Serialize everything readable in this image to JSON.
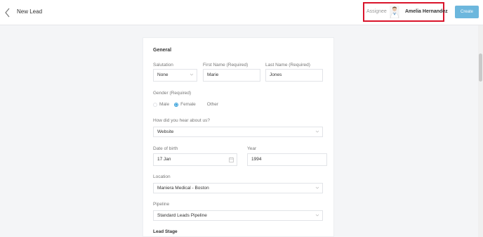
{
  "header": {
    "title": "New Lead",
    "assignee_label": "Assignee",
    "assignee_name": "Amelia Hernandez",
    "create_label": "Create"
  },
  "form": {
    "section_title": "General",
    "salutation": {
      "label": "Salutation",
      "value": "None"
    },
    "first_name": {
      "label": "First Name (Required)",
      "value": "Marie"
    },
    "last_name": {
      "label": "Last Name (Required)",
      "value": "Jones"
    },
    "gender": {
      "label": "Gender (Required)",
      "options": [
        "Male",
        "Female",
        "Other"
      ],
      "selected": "Female"
    },
    "source": {
      "label": "How did you hear about us?",
      "value": "Website"
    },
    "dob": {
      "label": "Date of birth",
      "value": "17 Jan"
    },
    "year": {
      "label": "Year",
      "value": "1994"
    },
    "location": {
      "label": "Location",
      "value": "Maniera Medical - Boston"
    },
    "pipeline": {
      "label": "Pipeline",
      "value": "Standard Leads Pipeline"
    },
    "lead_stage": {
      "label": "Lead Stage"
    }
  },
  "icons": {
    "back": "chevron-left-icon",
    "select": "chevron-down-icon",
    "calendar": "calendar-icon"
  },
  "colors": {
    "primary_button": "#6cb7dd",
    "radio_selected": "#2b9bd8",
    "highlight_border": "#d9142b"
  }
}
